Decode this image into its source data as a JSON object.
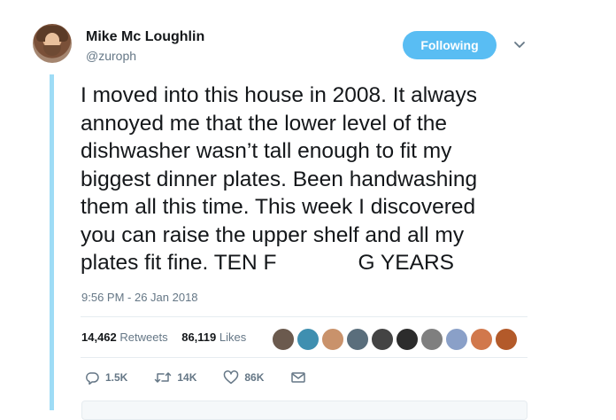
{
  "author": {
    "name": "Mike Mc Loughlin",
    "handle": "@zuroph"
  },
  "follow_button": {
    "label": "Following",
    "color": "#59bdf3"
  },
  "tweet": {
    "line1": "I moved into this house in 2008. It always",
    "line2": "annoyed me that the lower level of the",
    "line3": "dishwasher wasn’t tall enough to fit my",
    "line4": "biggest dinner plates. Been handwashing",
    "line5": "them all this time. This week I discovered",
    "line6": "you can raise the upper shelf and all my",
    "line7_a": "plates fit fine. TEN F",
    "line7_b": "G YEARS"
  },
  "timestamp": "9:56 PM - 26 Jan 2018",
  "stats": {
    "retweets_count": "14,462",
    "retweets_label": "Retweets",
    "likes_count": "86,119",
    "likes_label": "Likes"
  },
  "liker_avatars": [
    "#6b5a4e",
    "#3f8fb0",
    "#c9926b",
    "#5a6e7c",
    "#444444",
    "#2c2c2c",
    "#7f7f7f",
    "#8aa0c8",
    "#d1784c",
    "#b35a2a"
  ],
  "actions": {
    "reply_count": "1.5K",
    "retweet_count": "14K",
    "like_count": "86K"
  },
  "icons": {
    "reply": "reply-icon",
    "retweet": "retweet-icon",
    "like": "heart-icon",
    "dm": "envelope-icon",
    "more": "chevron-down-icon"
  }
}
